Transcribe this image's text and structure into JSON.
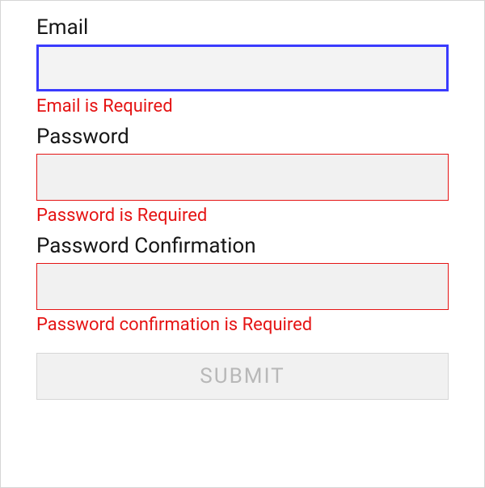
{
  "form": {
    "email": {
      "label": "Email",
      "value": "",
      "placeholder": "",
      "error": "Email is Required"
    },
    "password": {
      "label": "Password",
      "value": "",
      "placeholder": "",
      "error": "Password is Required"
    },
    "passwordConfirm": {
      "label": "Password Confirmation",
      "value": "",
      "placeholder": "",
      "error": "Password confirmation is Required"
    },
    "submit": {
      "label": "SUBMIT"
    }
  }
}
